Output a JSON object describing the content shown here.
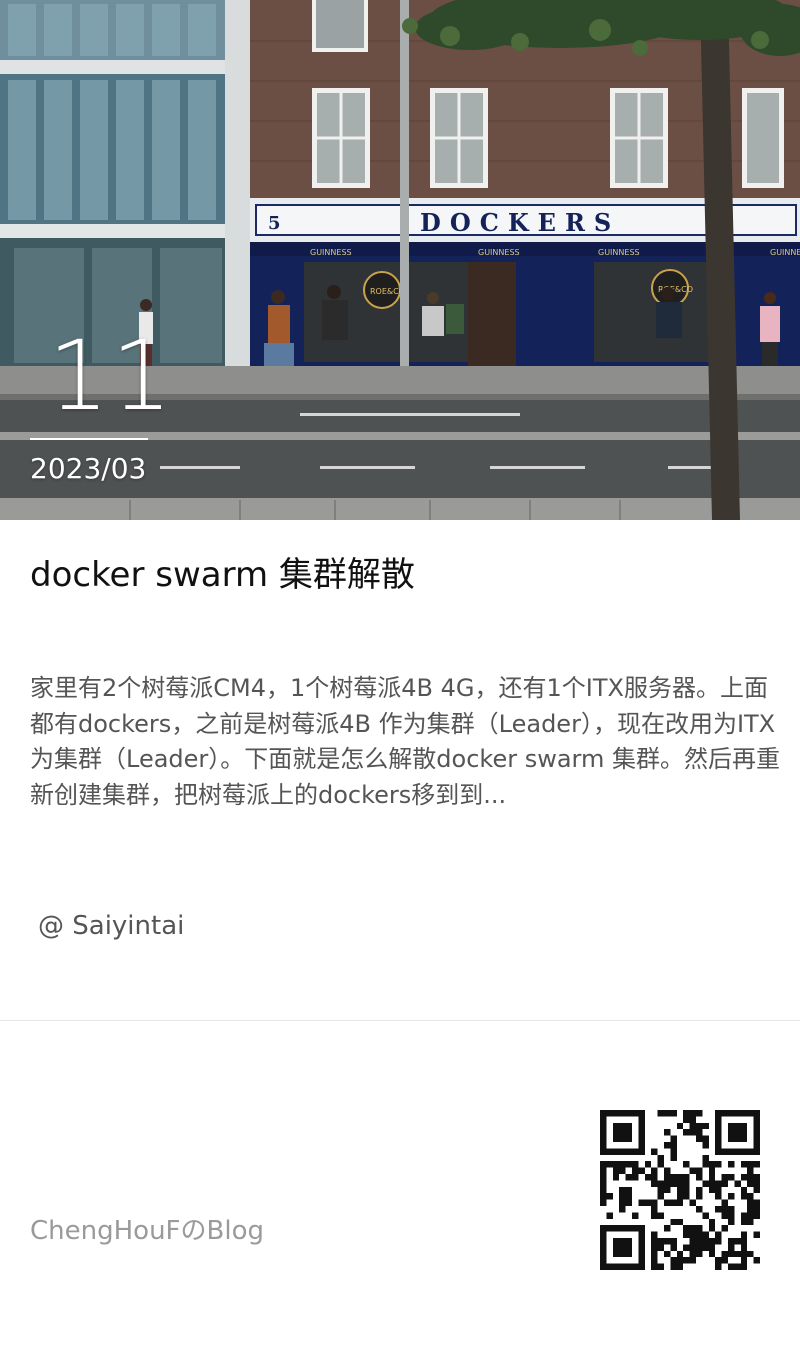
{
  "post": {
    "day": "11",
    "year_month": "2023/03",
    "title": "docker swarm 集群解散",
    "excerpt": "家里有2个树莓派CM4，1个树莓派4B 4G，还有1个ITX服务器。上面都有dockers，之前是树莓派4B 作为集群（Leader），现在改用为ITX为集群（Leader）。下面就是怎么解散docker swarm 集群。然后再重新创建集群，把树莓派上的dockers移到到...",
    "author": " @ Saiyintai"
  },
  "footer": {
    "blog_name": "ChengHouFのBlog",
    "qr_icon": "qr-code-icon"
  },
  "photo": {
    "storefront_sign": "DOCKERS",
    "street_number": "5",
    "brand_sign": "GUINNESS",
    "logo_text": "ROE&CO"
  },
  "colors": {
    "storefront": "#14225a",
    "brick": "#6b4f44",
    "title": "#111111",
    "body_text": "#555555",
    "muted_text": "#9a9a9a"
  }
}
